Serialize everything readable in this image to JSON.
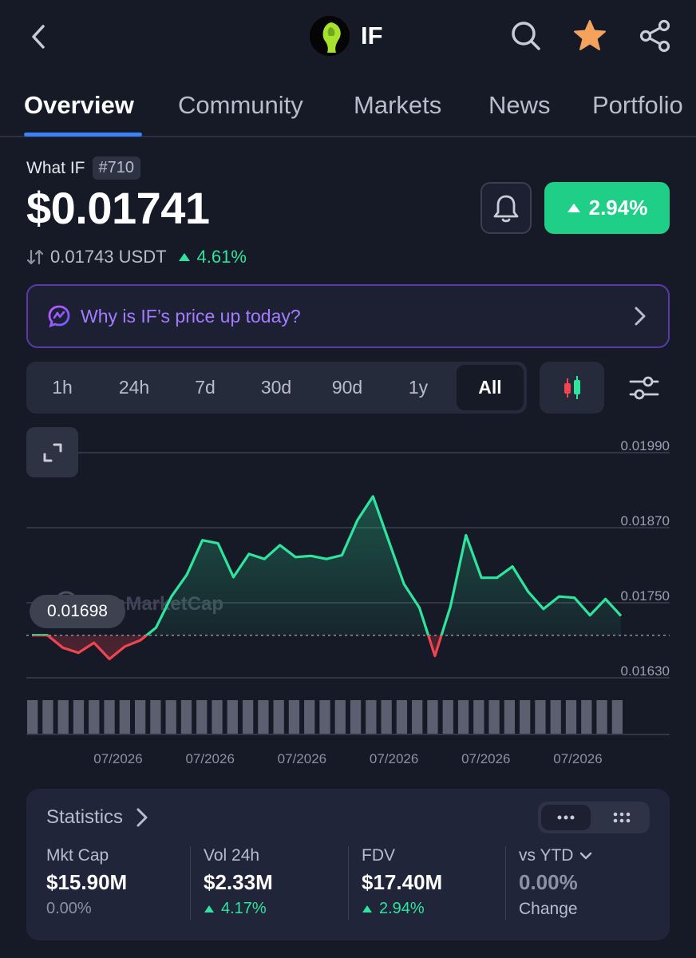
{
  "header": {
    "coin_symbol": "IF",
    "icons": [
      "back-arrow-icon",
      "search-icon",
      "star-icon",
      "share-icon"
    ],
    "star_color": "#f5a25d"
  },
  "tabs": [
    {
      "label": "Overview",
      "active": true
    },
    {
      "label": "Community"
    },
    {
      "label": "Markets"
    },
    {
      "label": "News"
    },
    {
      "label": "Portfolio"
    }
  ],
  "coin": {
    "name": "What IF",
    "rank": "#710",
    "price": "$0.01741",
    "usdt_price": "0.01743 USDT",
    "usdt_change": "4.61%",
    "change_24h": "2.94%",
    "accent_green": "#1fcf87"
  },
  "ai_banner": {
    "text": "Why is IF’s price up today?"
  },
  "range": {
    "options": [
      "1h",
      "24h",
      "7d",
      "30d",
      "90d",
      "1y",
      "All"
    ],
    "selected": "All"
  },
  "chart": {
    "current_label": "0.01698",
    "watermark": "CoinMarketCap"
  },
  "chart_data": {
    "type": "area",
    "x_tick_labels": [
      "07/2026",
      "07/2026",
      "07/2026",
      "07/2026",
      "07/2026",
      "07/2026"
    ],
    "y_tick_labels": [
      "0.01990",
      "0.01870",
      "0.01750",
      "0.01630"
    ],
    "ylim": [
      0.0163,
      0.0199
    ],
    "baseline": 0.01698,
    "colors": {
      "above": "#2ee59d",
      "below": "#f0444f"
    },
    "values": [
      0.01698,
      0.01698,
      0.01678,
      0.0167,
      0.01686,
      0.0166,
      0.0168,
      0.0169,
      0.0171,
      0.0176,
      0.01795,
      0.0185,
      0.01845,
      0.01791,
      0.01828,
      0.0182,
      0.01842,
      0.01823,
      0.01825,
      0.0182,
      0.01826,
      0.01882,
      0.0192,
      0.0185,
      0.0178,
      0.01742,
      0.01665,
      0.01744,
      0.01858,
      0.0179,
      0.0179,
      0.01808,
      0.01768,
      0.0174,
      0.0176,
      0.01758,
      0.0173,
      0.01756,
      0.01729
    ],
    "volume_bars": 39
  },
  "stats": {
    "title": "Statistics",
    "columns": [
      {
        "label": "Mkt Cap",
        "value": "$15.90M",
        "change": "0.00%",
        "direction": "flat"
      },
      {
        "label": "Vol 24h",
        "value": "$2.33M",
        "change": "4.17%",
        "direction": "up"
      },
      {
        "label": "FDV",
        "value": "$17.40M",
        "change": "2.94%",
        "direction": "up"
      },
      {
        "label": "vs YTD",
        "value": "0.00%",
        "change": "Change",
        "direction": "flat"
      }
    ]
  }
}
